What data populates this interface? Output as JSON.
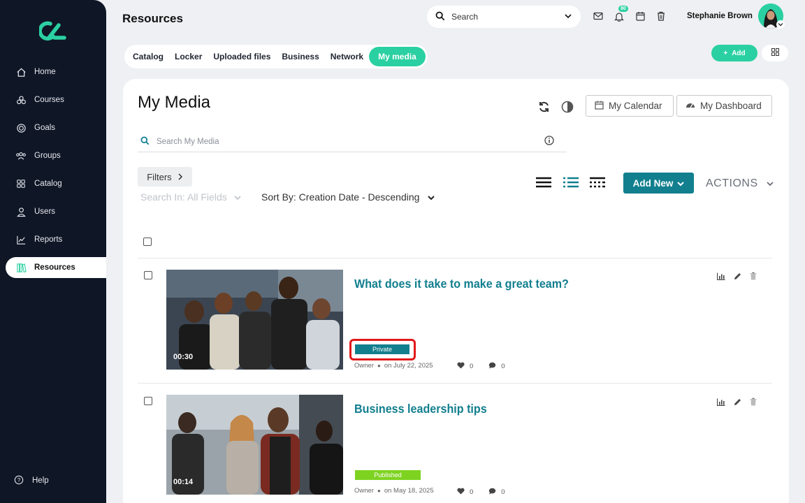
{
  "sidebar": {
    "items": [
      {
        "label": "Home",
        "icon": "home-icon"
      },
      {
        "label": "Courses",
        "icon": "courses-icon"
      },
      {
        "label": "Goals",
        "icon": "target-icon"
      },
      {
        "label": "Groups",
        "icon": "groups-icon"
      },
      {
        "label": "Catalog",
        "icon": "catalog-icon"
      },
      {
        "label": "Users",
        "icon": "user-icon"
      },
      {
        "label": "Reports",
        "icon": "chart-line-icon"
      },
      {
        "label": "Resources",
        "icon": "books-icon"
      }
    ],
    "active": "Resources",
    "help_label": "Help"
  },
  "header": {
    "title": "Resources",
    "search_placeholder": "Search",
    "notification_count": "80",
    "user_name": "Stephanie Brown"
  },
  "tabs": [
    {
      "label": "Catalog"
    },
    {
      "label": "Locker"
    },
    {
      "label": "Uploaded files"
    },
    {
      "label": "Business"
    },
    {
      "label": "Network"
    },
    {
      "label": "My media"
    }
  ],
  "active_tab": "My media",
  "toolbar": {
    "add_label": "Add"
  },
  "main": {
    "title": "My Media",
    "calendar_label": "My Calendar",
    "dashboard_label": "My Dashboard",
    "search_placeholder": "Search My Media",
    "filters_label": "Filters",
    "search_in": "Search In: All Fields",
    "sort_by": "Sort By: Creation Date - Descending",
    "add_new_label": "Add New",
    "actions_label": "ACTIONS"
  },
  "media_items": [
    {
      "title": "What does it take to make a great team?",
      "duration": "00:30",
      "status": "Private",
      "owner": "Owner",
      "date": "on July 22, 2025",
      "likes": "0",
      "comments": "0"
    },
    {
      "title": "Business leadership tips",
      "duration": "00:14",
      "status": "Published",
      "owner": "Owner",
      "date": "on May 18, 2025",
      "likes": "0",
      "comments": "0"
    }
  ],
  "colors": {
    "accent": "#2bd0a2",
    "teal": "#127f8f",
    "sidebar_bg": "#0f1626",
    "published": "#7ed321",
    "highlight": "#e11919"
  }
}
